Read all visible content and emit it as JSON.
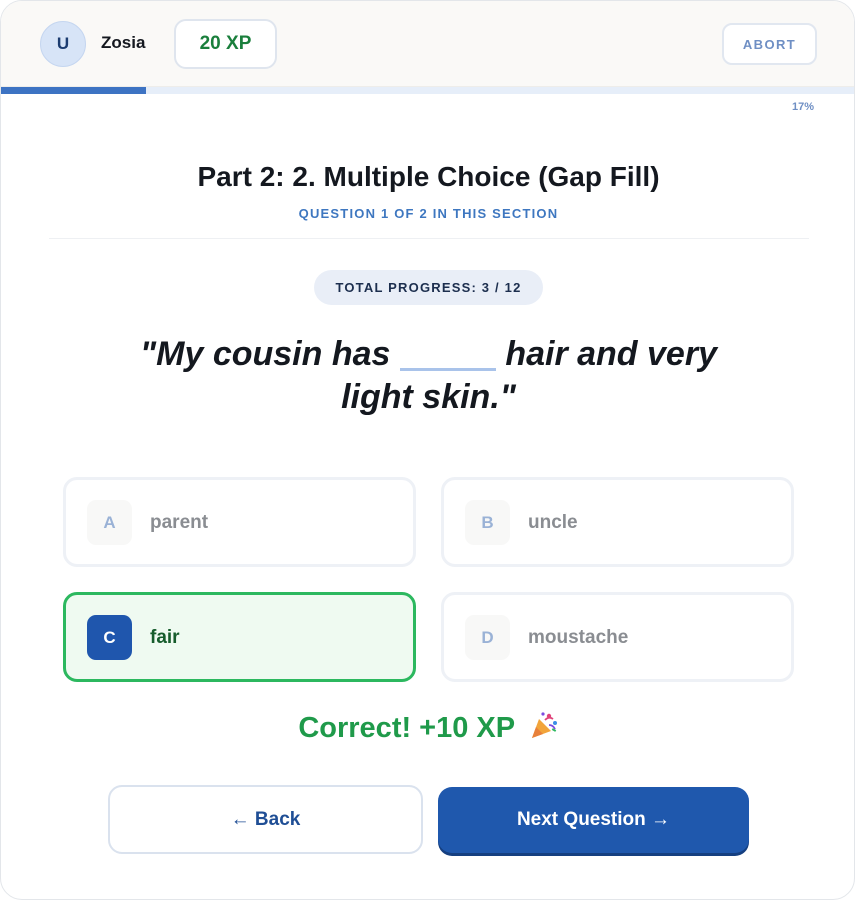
{
  "header": {
    "avatar_initial": "U",
    "username": "Zosia",
    "xp": "20 XP",
    "abort_label": "ABORT"
  },
  "progress": {
    "fraction": 0.17,
    "label": "17%"
  },
  "section": {
    "title": "Part 2: 2. Multiple Choice (Gap Fill)",
    "subtitle": "QUESTION 1 OF 2 IN THIS SECTION"
  },
  "total_progress": "TOTAL PROGRESS: 3 / 12",
  "question": {
    "before": "\"My cousin has ",
    "after": " hair and very light skin.\""
  },
  "options": [
    {
      "letter": "A",
      "text": "parent",
      "state": "default"
    },
    {
      "letter": "B",
      "text": "uncle",
      "state": "default"
    },
    {
      "letter": "C",
      "text": "fair",
      "state": "correct"
    },
    {
      "letter": "D",
      "text": "moustache",
      "state": "default"
    }
  ],
  "feedback": {
    "text": "Correct! +10 XP",
    "icon": "party-popper-icon"
  },
  "nav": {
    "back_label": "← Back",
    "next_label": "Next Question →"
  },
  "colors": {
    "primary": "#1f58ad",
    "correct": "#2cb85f",
    "correct_text": "#1f9a4a",
    "progress": "#3d73c3"
  }
}
